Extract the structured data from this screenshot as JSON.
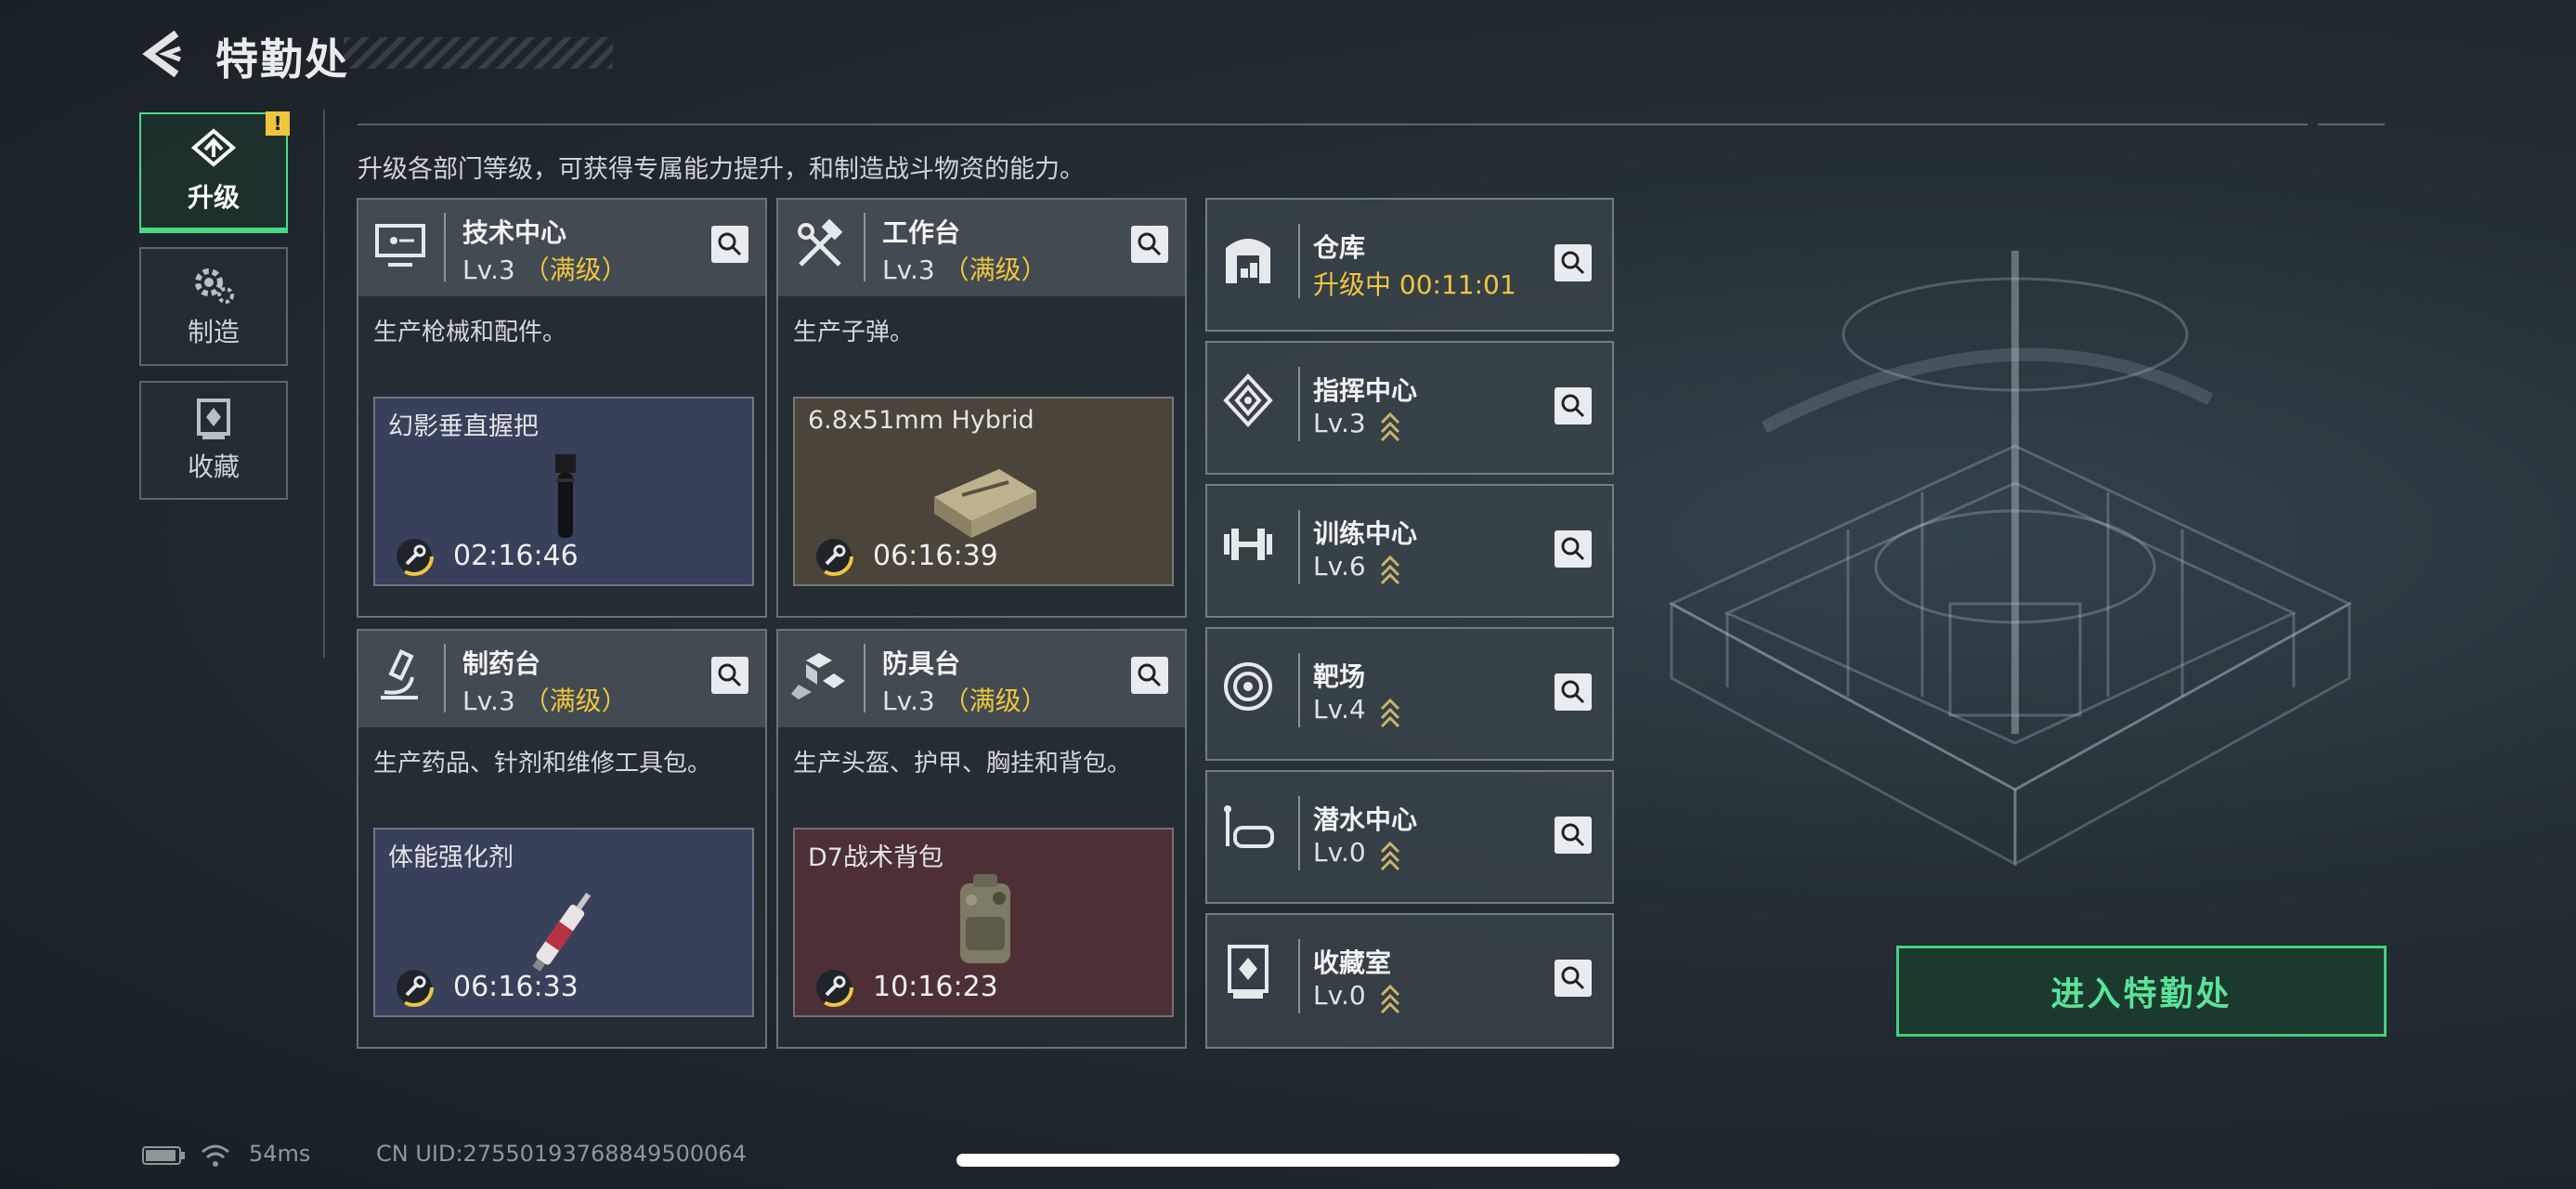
{
  "header": {
    "title": "特勤处"
  },
  "subtitle": "升级各部门等级，可获得专属能力提升，和制造战斗物资的能力。",
  "nav": [
    {
      "label": "升级",
      "icon": "upgrade-icon",
      "active": true
    },
    {
      "label": "制造",
      "icon": "craft-gear-icon",
      "active": false
    },
    {
      "label": "收藏",
      "icon": "collection-icon",
      "active": false
    }
  ],
  "nav_badge": "!",
  "departments": [
    {
      "name": "技术中心",
      "level": "Lv.3",
      "tag": "（满级）",
      "desc": "生产枪械和配件。",
      "product": {
        "name": "幻影垂直握把",
        "time": "02:16:46",
        "color": "#39405a"
      },
      "icon": "monitor-icon"
    },
    {
      "name": "工作台",
      "level": "Lv.3",
      "tag": "（满级）",
      "desc": "生产子弹。",
      "product": {
        "name": "6.8x51mm Hybrid",
        "time": "06:16:39",
        "color": "#4a443a"
      },
      "icon": "tools-icon"
    },
    {
      "name": "制药台",
      "level": "Lv.3",
      "tag": "（满级）",
      "desc": "生产药品、针剂和维修工具包。",
      "product": {
        "name": "体能强化剂",
        "time": "06:16:33",
        "color": "#39405a"
      },
      "icon": "microscope-icon"
    },
    {
      "name": "防具台",
      "level": "Lv.3",
      "tag": "（满级）",
      "desc": "生产头盔、护甲、胸挂和背包。",
      "product": {
        "name": "D7战术背包",
        "time": "10:16:23",
        "color": "#4c3036"
      },
      "icon": "armor-icon"
    }
  ],
  "facilities": [
    {
      "name": "仓库",
      "level": "升级中 00:11:01",
      "upgrading": true,
      "icon": "warehouse-icon"
    },
    {
      "name": "指挥中心",
      "level": "Lv.3",
      "upgrading": false,
      "icon": "command-icon"
    },
    {
      "name": "训练中心",
      "level": "Lv.6",
      "upgrading": false,
      "icon": "dumbbell-icon"
    },
    {
      "name": "靶场",
      "level": "Lv.4",
      "upgrading": false,
      "icon": "target-icon"
    },
    {
      "name": "潜水中心",
      "level": "Lv.0",
      "upgrading": false,
      "icon": "diving-mask-icon"
    },
    {
      "name": "收藏室",
      "level": "Lv.0",
      "upgrading": false,
      "icon": "collection-room-icon"
    }
  ],
  "enter_button": "进入特勤处",
  "status": {
    "ping": "54ms",
    "uid": "CN UID:27550193768849500064"
  },
  "colors": {
    "accent": "#4ad88a",
    "gold": "#f0c640"
  }
}
